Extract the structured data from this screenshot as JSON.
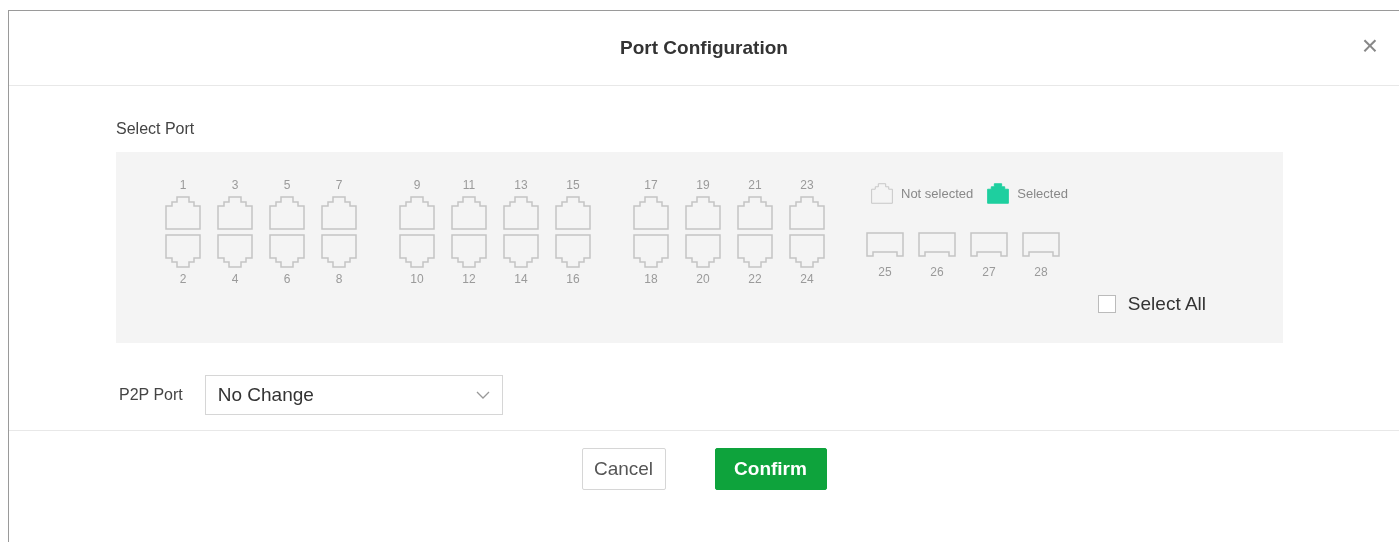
{
  "dialog": {
    "title": "Port Configuration",
    "close": "×"
  },
  "select_port": {
    "label": "Select Port",
    "port_groups": [
      {
        "kind": "rj45",
        "top": [
          {
            "label": "1",
            "selected": false
          },
          {
            "label": "3",
            "selected": false
          },
          {
            "label": "5",
            "selected": false
          },
          {
            "label": "7",
            "selected": false
          }
        ],
        "bottom": [
          {
            "label": "2",
            "selected": false
          },
          {
            "label": "4",
            "selected": false
          },
          {
            "label": "6",
            "selected": false
          },
          {
            "label": "8",
            "selected": false
          }
        ]
      },
      {
        "kind": "rj45",
        "top": [
          {
            "label": "9",
            "selected": false
          },
          {
            "label": "11",
            "selected": false
          },
          {
            "label": "13",
            "selected": false
          },
          {
            "label": "15",
            "selected": false
          }
        ],
        "bottom": [
          {
            "label": "10",
            "selected": false
          },
          {
            "label": "12",
            "selected": false
          },
          {
            "label": "14",
            "selected": false
          },
          {
            "label": "16",
            "selected": false
          }
        ]
      },
      {
        "kind": "rj45",
        "top": [
          {
            "label": "17",
            "selected": false
          },
          {
            "label": "19",
            "selected": false
          },
          {
            "label": "21",
            "selected": false
          },
          {
            "label": "23",
            "selected": false
          }
        ],
        "bottom": [
          {
            "label": "18",
            "selected": false
          },
          {
            "label": "20",
            "selected": false
          },
          {
            "label": "22",
            "selected": false
          },
          {
            "label": "24",
            "selected": false
          }
        ]
      },
      {
        "kind": "sfp",
        "bottom": [
          {
            "label": "25",
            "selected": false
          },
          {
            "label": "26",
            "selected": false
          },
          {
            "label": "27",
            "selected": false
          },
          {
            "label": "28",
            "selected": false
          }
        ]
      }
    ],
    "legend": {
      "not_selected": "Not selected",
      "selected": "Selected"
    },
    "select_all": {
      "label": "Select All",
      "checked": false
    }
  },
  "p2p_port": {
    "label": "P2P Port",
    "value": "No Change"
  },
  "buttons": [
    {
      "label": "Cancel",
      "kind": "secondary"
    },
    {
      "label": "Confirm",
      "kind": "primary"
    }
  ]
}
